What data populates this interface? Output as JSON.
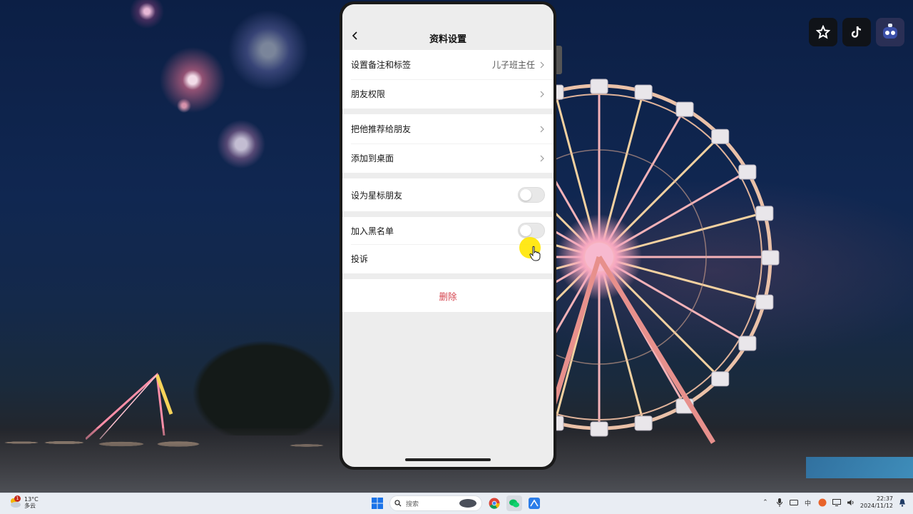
{
  "header": {
    "title": "资料设置"
  },
  "groups": [
    {
      "rows": [
        {
          "label": "设置备注和标签",
          "value": "儿子班主任",
          "type": "link"
        },
        {
          "label": "朋友权限",
          "value": "",
          "type": "link"
        }
      ]
    },
    {
      "rows": [
        {
          "label": "把他推荐给朋友",
          "type": "link"
        },
        {
          "label": "添加到桌面",
          "type": "link"
        }
      ]
    },
    {
      "rows": [
        {
          "label": "设为星标朋友",
          "type": "toggle",
          "on": false
        }
      ]
    },
    {
      "rows": [
        {
          "label": "加入黑名单",
          "type": "toggle",
          "on": false
        },
        {
          "label": "投诉",
          "type": "link"
        }
      ]
    }
  ],
  "actions": {
    "delete_label": "删除"
  },
  "taskbar": {
    "weather_temp": "13°C",
    "weather_desc": "多云",
    "weather_badge": "1",
    "search_placeholder": "搜索",
    "time": "22:37",
    "date": "2024/11/12"
  },
  "colors": {
    "delete": "#d5454f",
    "screen_bg": "#ededed",
    "cursor_highlight": "#ffe600"
  },
  "icons": {
    "back": "chevron-left-icon",
    "row_arrow": "chevron-right-icon",
    "top_right": [
      "star-app-icon",
      "tiktok-icon",
      "robot-avatar-icon"
    ]
  }
}
